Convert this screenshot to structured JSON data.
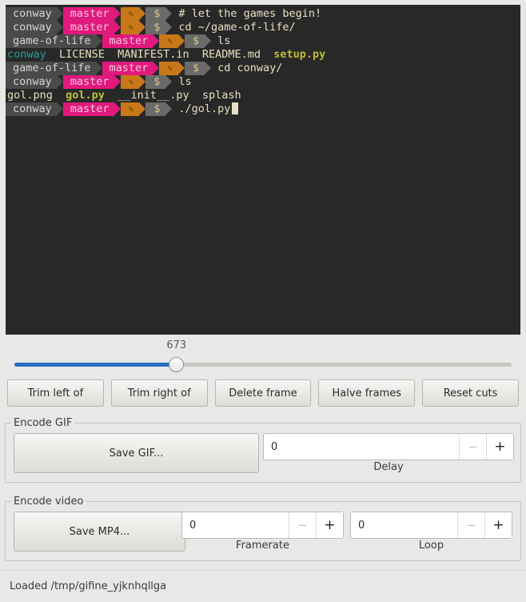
{
  "terminal": {
    "lines": [
      {
        "type": "prompt",
        "host": "conway",
        "branch": "master",
        "pencil": "pencil-icon",
        "dollar": "$",
        "command": "# let the games begin!"
      },
      {
        "type": "prompt",
        "host": "conway",
        "branch": "master",
        "pencil": "pencil-icon",
        "dollar": "$",
        "command": "cd ~/game-of-life/"
      },
      {
        "type": "prompt",
        "host": "game-of-life",
        "branch": "master",
        "pencil": "pencil-icon",
        "dollar": "$",
        "command": "ls"
      },
      {
        "type": "output",
        "parts": [
          {
            "text": "conway",
            "color": "teal"
          },
          {
            "text": "  LICENSE  MANIFEST.in  README.md  ",
            "color": "cream"
          },
          {
            "text": "setup.py",
            "color": "olive"
          }
        ]
      },
      {
        "type": "prompt",
        "host": "game-of-life",
        "branch": "master",
        "pencil": "pencil-icon",
        "dollar": "$",
        "command": "cd conway/"
      },
      {
        "type": "prompt",
        "host": "conway",
        "branch": "master",
        "pencil": "pencil-icon",
        "dollar": "$",
        "command": "ls"
      },
      {
        "type": "output",
        "parts": [
          {
            "text": "gol.png  ",
            "color": "cream"
          },
          {
            "text": "gol.py",
            "color": "olive"
          },
          {
            "text": "  __init__.py  splash",
            "color": "cream"
          }
        ]
      },
      {
        "type": "prompt",
        "host": "conway",
        "branch": "master",
        "pencil": "pencil-icon",
        "dollar": "$",
        "command": "./gol.py",
        "cursor": true
      }
    ]
  },
  "slider": {
    "value": "673",
    "min": 0,
    "max": 1000,
    "percent": 32.6
  },
  "cut_buttons": [
    {
      "label": "Trim left of",
      "name": "trim-left-of-button"
    },
    {
      "label": "Trim right of",
      "name": "trim-right-of-button"
    },
    {
      "label": "Delete frame",
      "name": "delete-frame-button"
    },
    {
      "label": "Halve frames",
      "name": "halve-frames-button"
    },
    {
      "label": "Reset cuts",
      "name": "reset-cuts-button"
    }
  ],
  "encode_gif": {
    "title": "Encode GIF",
    "save_label": "Save GIF...",
    "delay": {
      "value": "0",
      "label": "Delay",
      "minus": "−",
      "plus": "+"
    }
  },
  "encode_video": {
    "title": "Encode video",
    "save_label": "Save MP4...",
    "framerate": {
      "value": "0",
      "label": "Framerate",
      "minus": "−",
      "plus": "+"
    },
    "loop": {
      "value": "0",
      "label": "Loop",
      "minus": "−",
      "plus": "+"
    }
  },
  "statusbar": {
    "text": "Loaded /tmp/gifine_yjknhqllga"
  },
  "colors": {
    "terminal_bg": "#282828",
    "terminal_fg": "#e8e0c0",
    "prompt_host_bg": "#4a4a4a",
    "prompt_branch_bg": "#e0197d",
    "prompt_pencil_bg": "#c87818",
    "prompt_dollar_bg": "#6a6a6a",
    "slider_fill": "#2a6ec2",
    "window_bg": "#e8e8e6"
  }
}
